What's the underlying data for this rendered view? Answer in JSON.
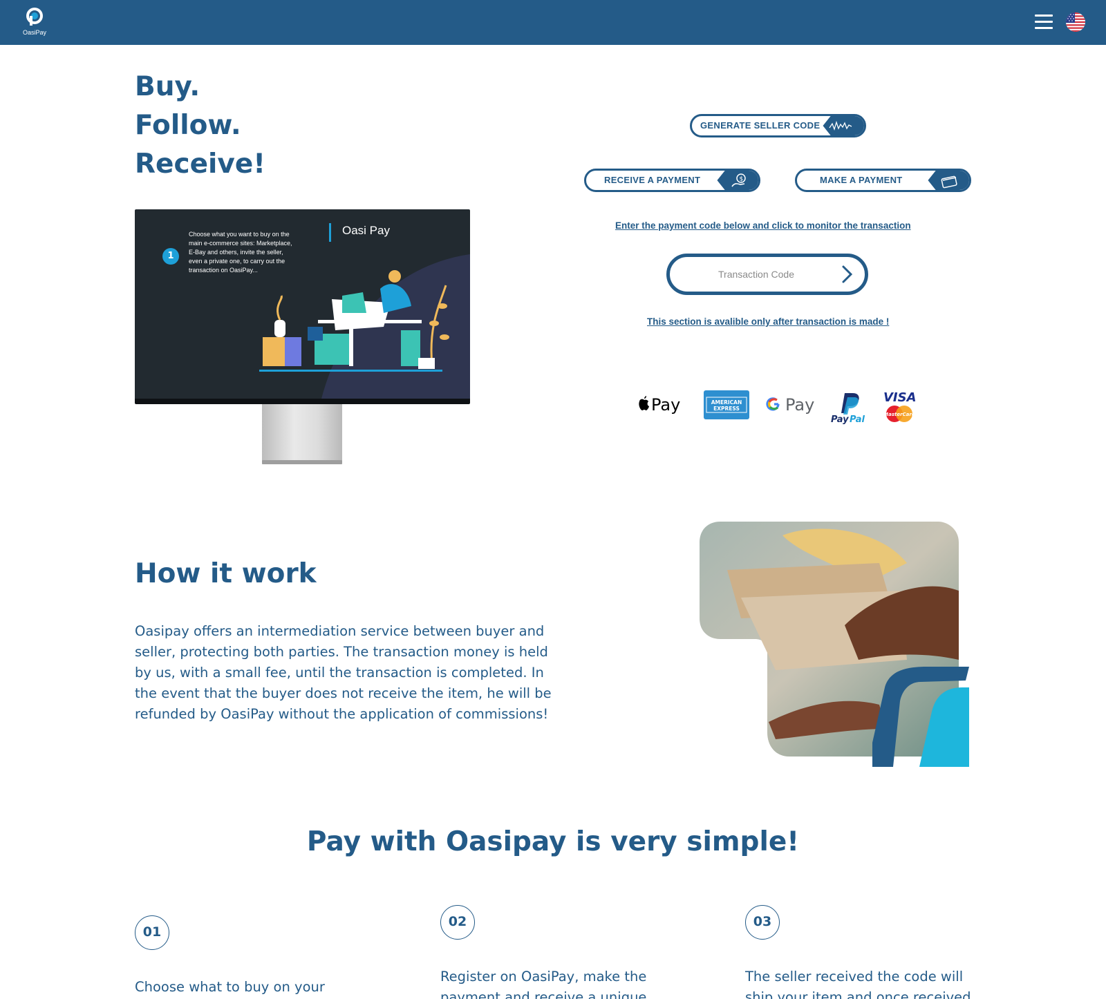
{
  "header": {
    "logo_text": "OasiPay",
    "menu_icon": "hamburger-menu-icon",
    "language_icon": "us-flag-icon"
  },
  "hero": {
    "lines": [
      "Buy.",
      "Follow.",
      "Receive!"
    ],
    "screen": {
      "step_number": "1",
      "step_text": "Choose what you want to buy on the main e-commerce sites: Marketplace, E-Bay and others, invite the seller, even a private one, to carry out the transaction on OasiPay...",
      "brand": "Oasi Pay"
    }
  },
  "actions": {
    "generate_seller_code": "GENERATE SELLER CODE",
    "receive_payment": "RECEIVE A PAYMENT",
    "make_payment": "MAKE A PAYMENT",
    "monitor_hint": "Enter the payment code below and click to monitor the transaction",
    "transaction_placeholder": "Transaction Code",
    "section_note": "This section is avalible only after transaction is made !"
  },
  "payment_methods": [
    "Apple Pay",
    "American Express",
    "Google Pay",
    "PayPal",
    "Visa / MasterCard"
  ],
  "how_it_works": {
    "title": "How it work",
    "text": "Oasipay offers an intermediation service between buyer and seller, protecting both parties. The transaction money is held by us, with a small fee, until the transaction is completed. In the event that the buyer does not receive the item, he will be refunded by OasiPay without the application of commissions!"
  },
  "simple": {
    "title": "Pay with Oasipay is very simple!",
    "steps": [
      {
        "num": "01",
        "text": "Choose what to buy on your"
      },
      {
        "num": "02",
        "text": "Register on OasiPay, make the payment and receive a unique"
      },
      {
        "num": "03",
        "text": "The seller received the code will ship your item and once received"
      }
    ]
  },
  "colors": {
    "primary": "#245b88",
    "accent": "#1ea0d8",
    "background": "#ffffff"
  }
}
